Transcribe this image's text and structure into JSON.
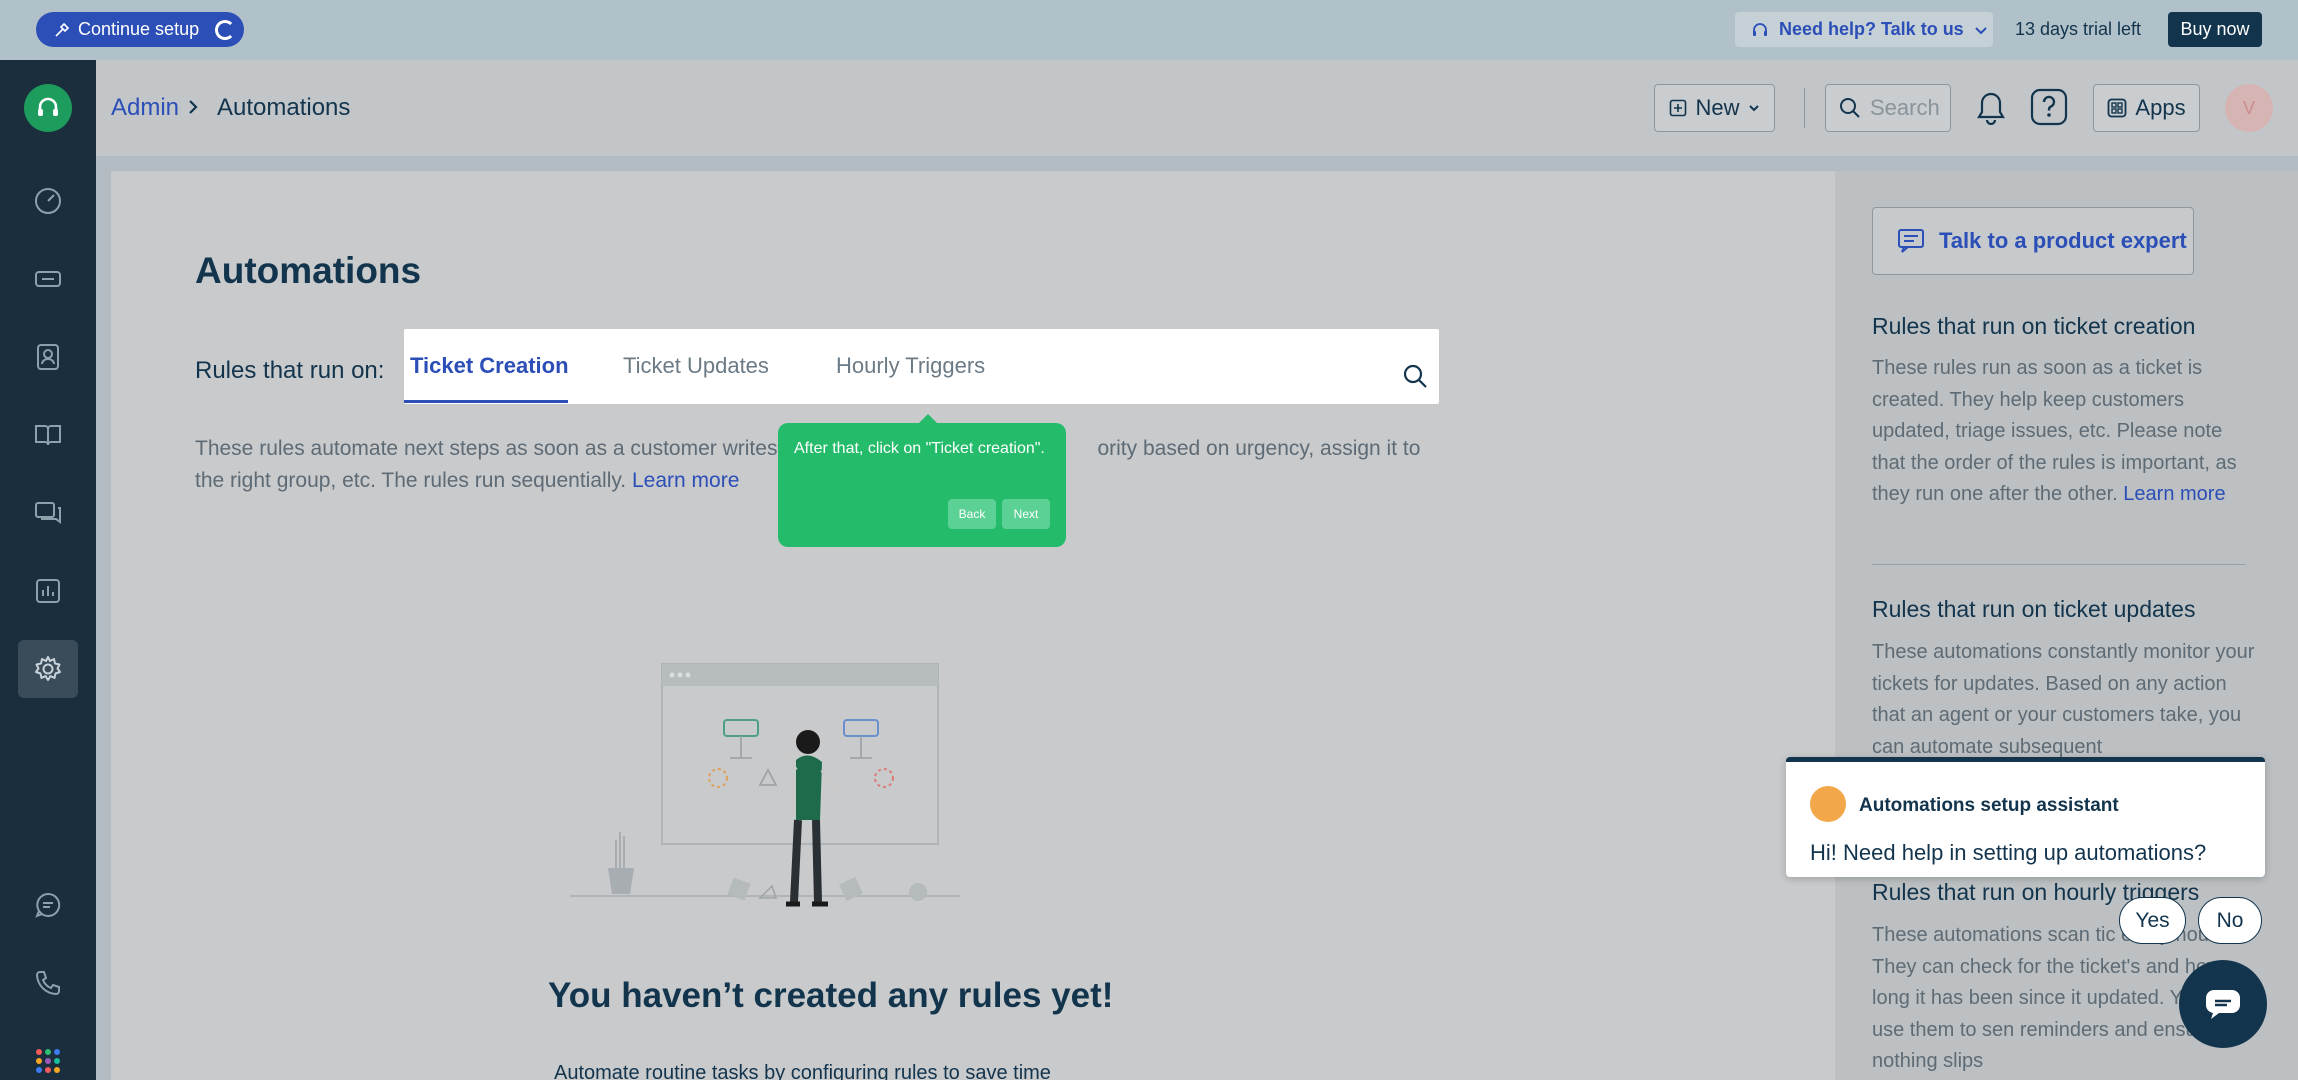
{
  "banner": {
    "continue_setup": "Continue setup",
    "need_help": "Need help? Talk to us",
    "trial": "13 days trial left",
    "buy_now": "Buy now"
  },
  "header": {
    "breadcrumb_root": "Admin",
    "breadcrumb_current": "Automations",
    "new_label": "New",
    "search_placeholder": "Search",
    "apps_label": "Apps",
    "avatar_initial": "V"
  },
  "main": {
    "title": "Automations",
    "rules_label": "Rules that run on:",
    "tabs": [
      {
        "label": "Ticket Creation",
        "active": true
      },
      {
        "label": "Ticket Updates",
        "active": false
      },
      {
        "label": "Hourly Triggers",
        "active": false
      }
    ],
    "description_part1": "These rules automate next steps as soon as a customer writes",
    "description_part2": "ority based on urgency, assign it to the right group, etc. The rules run sequentially.",
    "learn_more": "Learn more",
    "empty_title": "You haven’t created any rules yet!",
    "empty_sub": "Automate routine tasks by configuring rules to save time"
  },
  "tour": {
    "text": "After that, click on \"Ticket creation\".",
    "back": "Back",
    "next": "Next"
  },
  "right_panel": {
    "expert_button": "Talk to a product expert",
    "sections": [
      {
        "heading": "Rules that run on ticket creation",
        "text": "These rules run as soon as a ticket is created. They help keep customers updated, triage issues, etc. Please note that the order of the rules is important, as they run one after the other.",
        "link": "Learn more"
      },
      {
        "heading": "Rules that run on ticket updates",
        "text": "These automations constantly monitor your tickets for updates. Based on any action that an agent or your customers take, you can automate subsequent"
      },
      {
        "heading": "Rules that run on hourly triggers",
        "text": "These automations scan tic every hour. They can check for the ticket's and how long it has been since it updated. You can use them to sen reminders and ensure that nothing slips"
      }
    ]
  },
  "assistant": {
    "name": "Automations setup assistant",
    "message": "Hi! Need help in setting up automations?",
    "yes": "Yes",
    "no": "No"
  },
  "colors": {
    "brand_blue": "#2b4eb7",
    "sidebar": "#1a2e3e",
    "tour_green": "#24bc6a",
    "text_dark": "#12344d"
  }
}
